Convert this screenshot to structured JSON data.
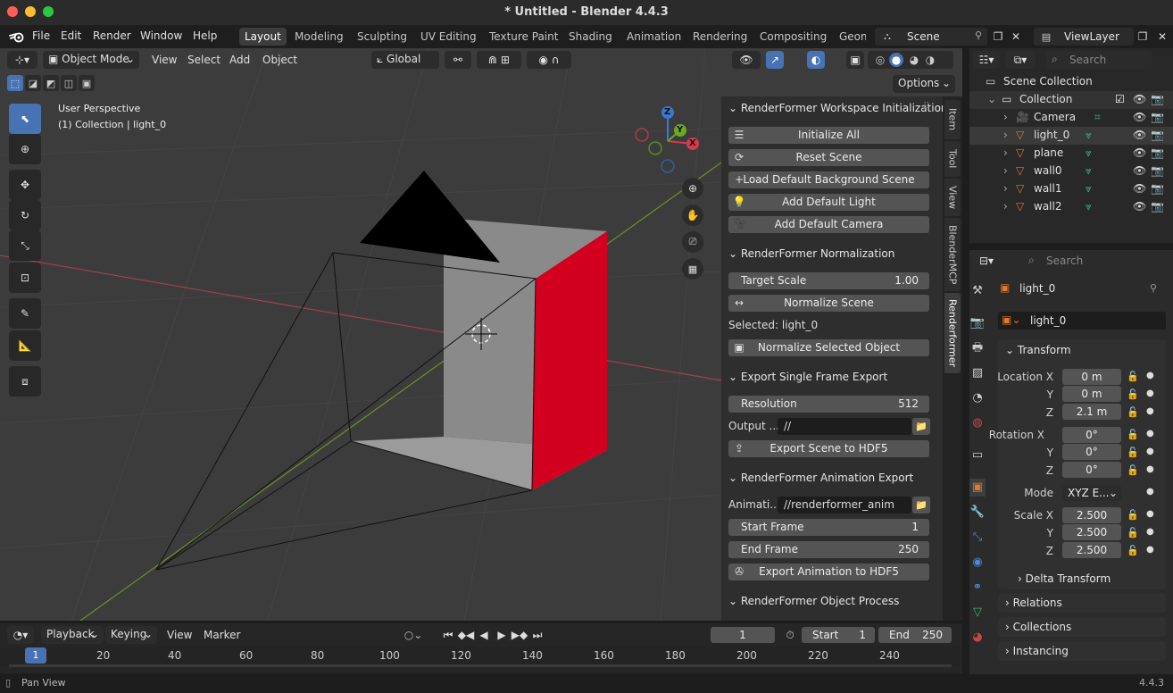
{
  "window": {
    "title": "* Untitled - Blender 4.4.3"
  },
  "menu": {
    "items": [
      "File",
      "Edit",
      "Render",
      "Window",
      "Help"
    ]
  },
  "workspaces": [
    "Layout",
    "Modeling",
    "Sculpting",
    "UV Editing",
    "Texture Paint",
    "Shading",
    "Animation",
    "Rendering",
    "Compositing",
    "Geom"
  ],
  "scene": {
    "label": "Scene",
    "view_layer": "ViewLayer"
  },
  "viewport_header": {
    "mode": "Object Mode",
    "menus": [
      "View",
      "Select",
      "Add",
      "Object"
    ],
    "orientation": "Global",
    "options": "Options"
  },
  "viewport": {
    "perspective": "User Perspective",
    "collection_info": "(1) Collection | light_0"
  },
  "gizmo": {
    "x": "X",
    "y": "Y",
    "z": "Z"
  },
  "npanel": {
    "sections": {
      "init": {
        "title": "RenderFormer Workspace Initialization",
        "buttons": [
          "Initialize All",
          "Reset Scene",
          "Load Default Background Scene",
          "Add Default Light",
          "Add Default Camera"
        ]
      },
      "normalization": {
        "title": "RenderFormer Normalization",
        "target_scale_label": "Target Scale",
        "target_scale_value": "1.00",
        "normalize_scene": "Normalize Scene",
        "selected": "Selected: light_0",
        "normalize_selected": "Normalize Selected Object"
      },
      "single_frame": {
        "title": "Export Single Frame Export",
        "resolution_label": "Resolution",
        "resolution_value": "512",
        "output_label": "Output ...",
        "output_value": "//",
        "export_button": "Export Scene to HDF5"
      },
      "animation": {
        "title": "RenderFormer Animation Export",
        "anim_label": "Animati...",
        "anim_value": "//renderformer_anim",
        "start_label": "Start Frame",
        "start_value": "1",
        "end_label": "End Frame",
        "end_value": "250",
        "export_button": "Export Animation to HDF5"
      },
      "object_process": {
        "title": "RenderFormer Object Process"
      }
    },
    "tabs": [
      "Item",
      "Tool",
      "View",
      "BlenderMCP",
      "Renderformer"
    ]
  },
  "outliner": {
    "search_placeholder": "Search",
    "root": "Scene Collection",
    "collection": "Collection",
    "objects": [
      "Camera",
      "light_0",
      "plane",
      "wall0",
      "wall1",
      "wall2"
    ]
  },
  "properties": {
    "search_placeholder": "Search",
    "object_name": "light_0",
    "data_name": "light_0",
    "transform_title": "Transform",
    "location": {
      "label": "Location X",
      "x": "0 m",
      "y_label": "Y",
      "y": "0 m",
      "z_label": "Z",
      "z": "2.1 m"
    },
    "rotation": {
      "label": "Rotation X",
      "x": "0°",
      "y_label": "Y",
      "y": "0°",
      "z_label": "Z",
      "z": "0°"
    },
    "mode": {
      "label": "Mode",
      "value": "XYZ E..."
    },
    "scale": {
      "label": "Scale X",
      "x": "2.500",
      "y_label": "Y",
      "y": "2.500",
      "z_label": "Z",
      "z": "2.500"
    },
    "delta_transform": "Delta Transform",
    "relations": "Relations",
    "collections": "Collections",
    "instancing": "Instancing"
  },
  "timeline": {
    "menus": [
      "Playback",
      "Keying",
      "View",
      "Marker"
    ],
    "current_frame": "1",
    "start_label": "Start",
    "start_value": "1",
    "end_label": "End",
    "end_value": "250",
    "ruler": [
      "1",
      "20",
      "40",
      "60",
      "80",
      "100",
      "120",
      "140",
      "160",
      "180",
      "200",
      "220",
      "240"
    ]
  },
  "status": {
    "hint": "Pan View",
    "version": "4.4.3"
  }
}
